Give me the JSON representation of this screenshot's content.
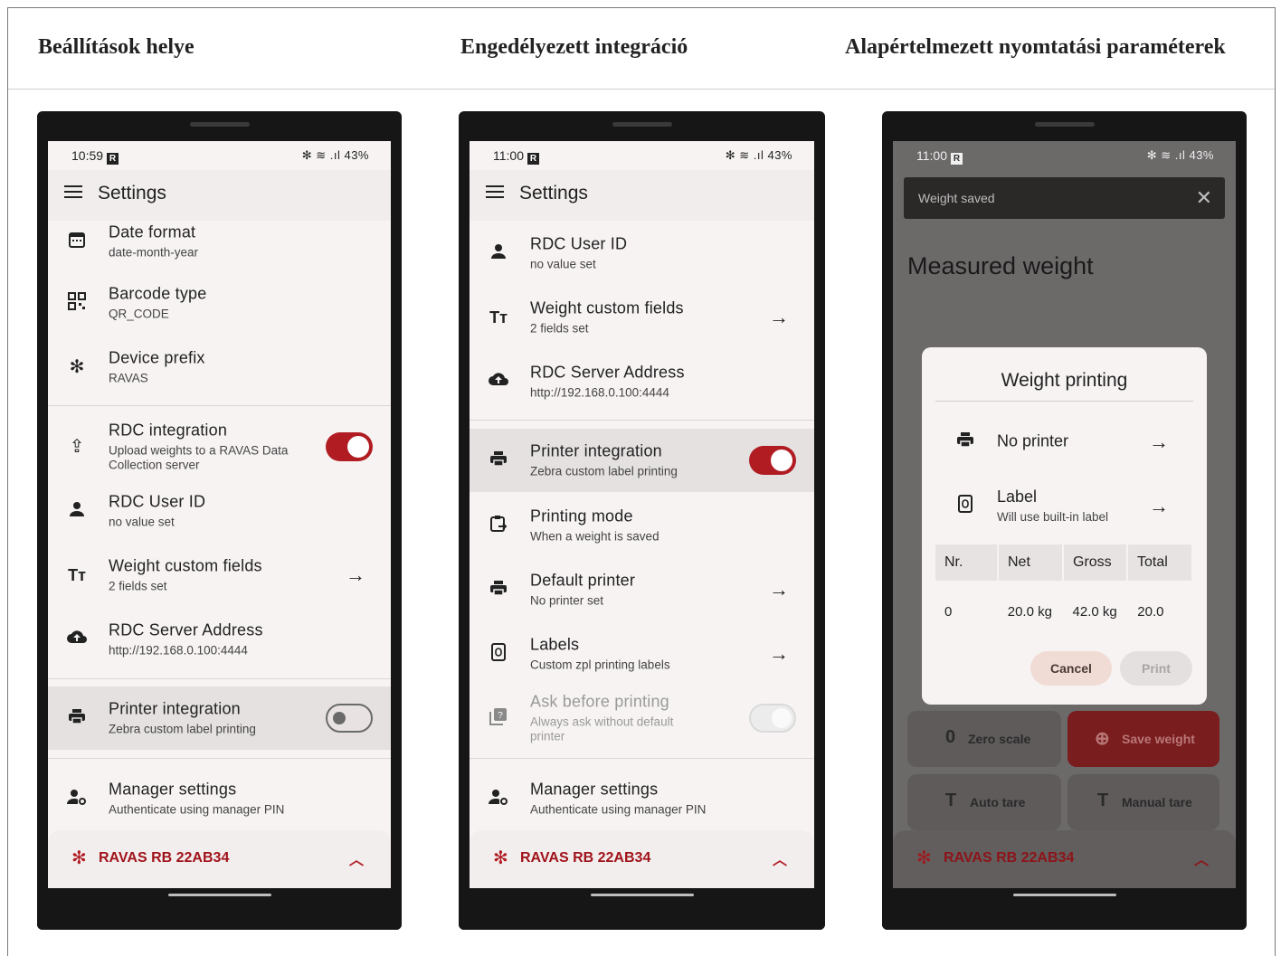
{
  "columns": [
    "Beállítások helye",
    "Engedélyezett integráció",
    "Alapértelmezett nyomtatási paraméterek"
  ],
  "phones": [
    {
      "time": "10:59",
      "status_right": "✻ ≋ .ıl 43%",
      "appbar_title": "Settings",
      "rows": [
        {
          "icon": "calendar-icon",
          "title": "Date format",
          "subtitle": "date-month-year"
        },
        {
          "icon": "qr-code-icon",
          "title": "Barcode type",
          "subtitle": "QR_CODE"
        },
        {
          "icon": "bluetooth-icon",
          "title": "Device prefix",
          "subtitle": "RAVAS"
        },
        {
          "icon": "upload-scale-icon",
          "title": "RDC integration",
          "subtitle": "Upload weights to a RAVAS Data Collection server",
          "toggle": "on"
        },
        {
          "icon": "person-icon",
          "title": "RDC User ID",
          "subtitle": "no value set"
        },
        {
          "icon": "text-fields-icon",
          "title": "Weight custom fields",
          "subtitle": "2 fields set",
          "arrow": true
        },
        {
          "icon": "cloud-upload-icon",
          "title": "RDC Server Address",
          "subtitle": "http://192.168.0.100:4444"
        },
        {
          "icon": "printer-icon",
          "title": "Printer integration",
          "subtitle": "Zebra custom label printing",
          "toggle": "off"
        },
        {
          "icon": "manager-icon",
          "title": "Manager settings",
          "subtitle": "Authenticate using manager PIN"
        }
      ],
      "device": "RAVAS RB 22AB34"
    },
    {
      "time": "11:00",
      "status_right": "✻ ≋ .ıl 43%",
      "appbar_title": "Settings",
      "rows": [
        {
          "icon": "person-icon",
          "title": "RDC User ID",
          "subtitle": "no value set"
        },
        {
          "icon": "text-fields-icon",
          "title": "Weight custom fields",
          "subtitle": "2 fields set",
          "arrow": true
        },
        {
          "icon": "cloud-upload-icon",
          "title": "RDC Server Address",
          "subtitle": "http://192.168.0.100:4444"
        },
        {
          "icon": "printer-icon",
          "title": "Printer integration",
          "subtitle": "Zebra custom label printing",
          "toggle": "on"
        },
        {
          "icon": "print-mode-icon",
          "title": "Printing mode",
          "subtitle": "When a weight is saved"
        },
        {
          "icon": "printer-icon",
          "title": "Default printer",
          "subtitle": "No printer set",
          "arrow": true
        },
        {
          "icon": "label-file-icon",
          "title": "Labels",
          "subtitle": "Custom zpl printing labels",
          "arrow": true
        },
        {
          "icon": "help-icon",
          "title": "Ask before printing",
          "subtitle": "Always ask without default printer",
          "toggle": "disabled"
        },
        {
          "icon": "manager-icon",
          "title": "Manager settings",
          "subtitle": "Authenticate using manager PIN"
        }
      ],
      "device": "RAVAS RB 22AB34"
    },
    {
      "time": "11:00",
      "status_right": "✻ ≋ .ıl 43%",
      "snackbar": "Weight saved",
      "heading": "Measured weight",
      "dialog": {
        "title": "Weight printing",
        "rows": [
          {
            "icon": "printer-icon",
            "title": "No printer",
            "subtitle": ""
          },
          {
            "icon": "label-file-icon",
            "title": "Label",
            "subtitle": "Will use built-in label"
          }
        ],
        "table": {
          "headers": [
            "Nr.",
            "Net",
            "Gross",
            "Total"
          ],
          "rows": [
            [
              "0",
              "20.0 kg",
              "42.0 kg",
              "20.0"
            ]
          ]
        },
        "cancel": "Cancel",
        "print": "Print"
      },
      "buttons": {
        "zero_scale": "Zero scale",
        "zero_icon": "0",
        "save_weight": "Save weight",
        "auto_tare": "Auto tare",
        "manual_tare": "Manual tare",
        "tare_icon": "T"
      },
      "device": "RAVAS RB 22AB34"
    }
  ],
  "colors": {
    "accent": "#b01c22",
    "brand_red": "#a0131a",
    "screen_bg": "#f7f3f3"
  }
}
